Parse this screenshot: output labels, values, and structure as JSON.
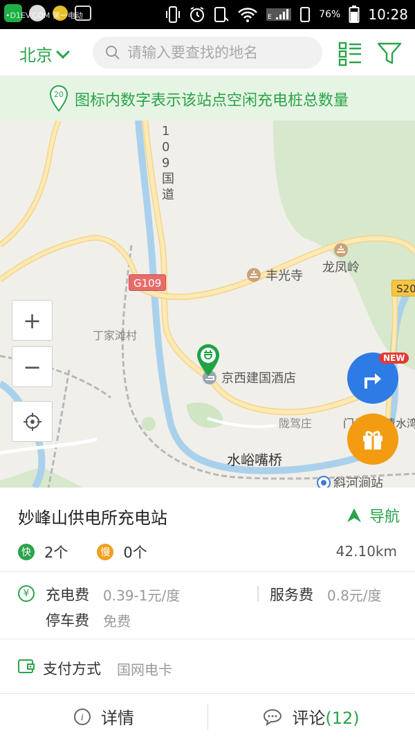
{
  "status_bar": {
    "battery": "76%",
    "time": "10:28",
    "watermark": "•D1EV.COM 第一电动"
  },
  "header": {
    "city": "北京",
    "search_placeholder": "请输入要查找的地名",
    "list_icon": "list-icon",
    "filter_icon": "filter-icon"
  },
  "notice": {
    "pin_number": "20",
    "text": "图标内数字表示该站点空闲充电桩总数量"
  },
  "map": {
    "labels": {
      "road_109": "109国道",
      "g109": "G109",
      "s20": "S20",
      "fengguangsi": "丰光寺",
      "longfengling": "龙凤岭",
      "dingjiatan": "丁家滩村",
      "jingxi_hotel": "京西建国酒店",
      "longjiazhuang": "陇驾庄",
      "shuiyuzui": "水峪嘴桥",
      "xiehejian": "斜河涧站",
      "menkou": "门头沟",
      "qingshui": "清水湾"
    },
    "zoom_in": "+",
    "zoom_out": "−",
    "new_tag": "NEW"
  },
  "station": {
    "name": "妙峰山供电所充电站",
    "nav_label": "导航",
    "fast_badge": "快",
    "fast_count": "2个",
    "slow_badge": "慢",
    "slow_count": "0个",
    "distance": "42.10km",
    "fee_icon": "¥",
    "charge_fee_label": "充电费",
    "charge_fee_value": "0.39-1元/度",
    "service_fee_label": "服务费",
    "service_fee_value": "0.8元/度",
    "parking_fee_label": "停车费",
    "parking_fee_value": "免费",
    "payment_label": "支付方式",
    "payment_value": "国网电卡"
  },
  "tabs": {
    "details": "详情",
    "comments": "评论",
    "comments_count": "(12)"
  },
  "colors": {
    "brand_green": "#2aa34a",
    "nav_blue": "#2f7be5",
    "gift_orange": "#f39c12",
    "slow_orange": "#f0a020"
  }
}
